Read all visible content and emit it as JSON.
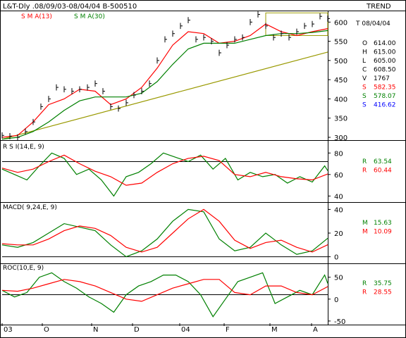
{
  "header": {
    "title": "L&T-Dly .08/09/03-08/04/04  B-500510",
    "trend_label": "TREND",
    "sma_short_label": "S M A(13)",
    "sma_long_label": "S M A(30)"
  },
  "colors": {
    "price_bars": "#000000",
    "sma_short": "#ff0000",
    "sma_long": "#008000",
    "trendline": "#999900",
    "box": "#000000",
    "support_value": "#0000ff"
  },
  "chart_data": [
    {
      "type": "line",
      "title": "",
      "ylim": [
        300,
        630
      ],
      "y_ticks": [
        300,
        350,
        400,
        450,
        500,
        550,
        600
      ],
      "x_month_labels": [
        "03",
        "O",
        "N",
        "D",
        "04",
        "F",
        "M",
        "A"
      ],
      "readout": {
        "date": "T 08/04/04",
        "rows": [
          {
            "k": "O",
            "v": "614.00",
            "color": "#000000"
          },
          {
            "k": "H",
            "v": "615.00",
            "color": "#000000"
          },
          {
            "k": "L",
            "v": "605.00",
            "color": "#000000"
          },
          {
            "k": "C",
            "v": "608.50",
            "color": "#000000"
          },
          {
            "k": "V",
            "v": "1767",
            "color": "#000000"
          },
          {
            "k": "S",
            "v": "582.35",
            "color": "#ff0000"
          },
          {
            "k": "S",
            "v": "578.07",
            "color": "#008000"
          },
          {
            "k": "S",
            "v": "416.62",
            "color": "#0000ff"
          }
        ]
      },
      "series": [
        {
          "name": "S M A(13)",
          "x": [
            0,
            10,
            20,
            30,
            40,
            50,
            60,
            70,
            80,
            90,
            100,
            110,
            120,
            130,
            140,
            150,
            160,
            170,
            180,
            190,
            200,
            210
          ],
          "values": [
            300,
            305,
            340,
            385,
            400,
            425,
            420,
            385,
            400,
            430,
            480,
            540,
            575,
            570,
            545,
            550,
            565,
            595,
            575,
            565,
            575,
            583
          ]
        },
        {
          "name": "S M A(30)",
          "x": [
            0,
            10,
            20,
            30,
            40,
            50,
            60,
            70,
            80,
            90,
            100,
            110,
            120,
            130,
            140,
            150,
            160,
            170,
            180,
            190,
            200,
            210
          ],
          "values": [
            295,
            300,
            315,
            340,
            370,
            395,
            405,
            405,
            405,
            415,
            445,
            490,
            530,
            545,
            545,
            545,
            555,
            565,
            570,
            570,
            573,
            578
          ]
        },
        {
          "name": "close",
          "x": [
            0,
            5,
            10,
            15,
            20,
            25,
            30,
            35,
            40,
            45,
            50,
            55,
            60,
            65,
            70,
            75,
            80,
            85,
            90,
            95,
            100,
            105,
            110,
            115,
            120,
            125,
            130,
            135,
            140,
            145,
            150,
            155,
            160,
            165,
            170,
            175,
            180,
            185,
            190,
            195,
            200,
            205,
            210
          ],
          "values": [
            305,
            303,
            300,
            315,
            340,
            380,
            400,
            430,
            425,
            420,
            425,
            430,
            440,
            420,
            380,
            375,
            390,
            410,
            420,
            440,
            500,
            555,
            570,
            590,
            605,
            555,
            560,
            550,
            520,
            540,
            555,
            560,
            600,
            620,
            590,
            560,
            570,
            560,
            575,
            590,
            595,
            615,
            609
          ]
        }
      ],
      "trendline": {
        "x": [
          0,
          210
        ],
        "values": [
          295,
          522
        ]
      },
      "resistance_box": {
        "x": [
          170,
          210
        ],
        "top": 624,
        "bottom": 565
      }
    },
    {
      "type": "line",
      "title": "R S I(14,E, 9)",
      "ylim": [
        35,
        90
      ],
      "y_ticks": [
        40,
        60,
        80
      ],
      "ref_line": 72,
      "readout": [
        {
          "k": "R",
          "v": "63.54",
          "color": "#008000"
        },
        {
          "k": "R",
          "v": "60.44",
          "color": "#ff0000"
        }
      ],
      "series": [
        {
          "name": "R",
          "x": [
            0,
            8,
            16,
            24,
            32,
            40,
            48,
            56,
            64,
            72,
            80,
            88,
            96,
            104,
            112,
            120,
            128,
            136,
            144,
            152,
            160,
            168,
            176,
            184,
            192,
            200,
            208,
            210
          ],
          "values": [
            65,
            60,
            55,
            68,
            80,
            75,
            60,
            65,
            55,
            40,
            58,
            62,
            70,
            80,
            76,
            72,
            78,
            65,
            75,
            55,
            62,
            58,
            60,
            52,
            58,
            53,
            68,
            63.54
          ]
        },
        {
          "name": "R",
          "x": [
            0,
            10,
            20,
            30,
            40,
            50,
            60,
            70,
            80,
            90,
            100,
            110,
            120,
            130,
            140,
            150,
            160,
            170,
            180,
            190,
            200,
            210
          ],
          "values": [
            66,
            62,
            65,
            72,
            78,
            70,
            63,
            58,
            50,
            52,
            62,
            70,
            75,
            77,
            73,
            60,
            58,
            62,
            58,
            56,
            55,
            60.44
          ]
        }
      ]
    },
    {
      "type": "line",
      "title": "MACD( 9,24,E, 9)",
      "ylim": [
        -5,
        45
      ],
      "y_ticks": [
        0,
        20,
        40
      ],
      "ref_line": 0,
      "readout": [
        {
          "k": "M",
          "v": "15.63",
          "color": "#008000"
        },
        {
          "k": "M",
          "v": "10.09",
          "color": "#ff0000"
        }
      ],
      "series": [
        {
          "name": "M",
          "x": [
            0,
            10,
            20,
            30,
            40,
            50,
            60,
            70,
            80,
            90,
            100,
            110,
            120,
            130,
            140,
            150,
            160,
            170,
            180,
            190,
            200,
            210
          ],
          "values": [
            10,
            8,
            12,
            20,
            28,
            25,
            22,
            10,
            0,
            5,
            15,
            30,
            40,
            38,
            15,
            5,
            8,
            20,
            10,
            2,
            5,
            15.63
          ]
        },
        {
          "name": "M",
          "x": [
            0,
            10,
            20,
            30,
            40,
            50,
            60,
            70,
            80,
            90,
            100,
            110,
            120,
            130,
            140,
            150,
            160,
            170,
            180,
            190,
            200,
            210
          ],
          "values": [
            11,
            10,
            10,
            15,
            22,
            26,
            24,
            18,
            8,
            4,
            8,
            20,
            32,
            40,
            30,
            14,
            7,
            12,
            14,
            8,
            4,
            10.09
          ]
        }
      ]
    },
    {
      "type": "line",
      "title": "ROC(10,E, 9)",
      "ylim": [
        -55,
        80
      ],
      "y_ticks": [
        -50,
        0,
        50
      ],
      "ref_line": 10,
      "readout": [
        {
          "k": "R",
          "v": "35.75",
          "color": "#008000"
        },
        {
          "k": "R",
          "v": "28.55",
          "color": "#ff0000"
        }
      ],
      "series": [
        {
          "name": "R",
          "x": [
            0,
            8,
            16,
            24,
            32,
            40,
            48,
            56,
            64,
            72,
            80,
            88,
            96,
            104,
            112,
            120,
            128,
            136,
            144,
            152,
            160,
            168,
            176,
            184,
            192,
            200,
            208,
            210
          ],
          "values": [
            20,
            5,
            15,
            50,
            60,
            40,
            25,
            5,
            -10,
            -30,
            10,
            30,
            40,
            55,
            55,
            40,
            10,
            -40,
            0,
            40,
            50,
            60,
            -10,
            5,
            20,
            10,
            55,
            35.75
          ]
        },
        {
          "name": "R",
          "x": [
            0,
            10,
            20,
            30,
            40,
            50,
            60,
            70,
            80,
            90,
            100,
            110,
            120,
            130,
            140,
            150,
            160,
            170,
            180,
            190,
            200,
            210
          ],
          "values": [
            20,
            18,
            25,
            35,
            45,
            40,
            30,
            15,
            0,
            -5,
            10,
            25,
            35,
            45,
            45,
            15,
            10,
            30,
            30,
            15,
            10,
            28.55
          ]
        }
      ]
    }
  ]
}
